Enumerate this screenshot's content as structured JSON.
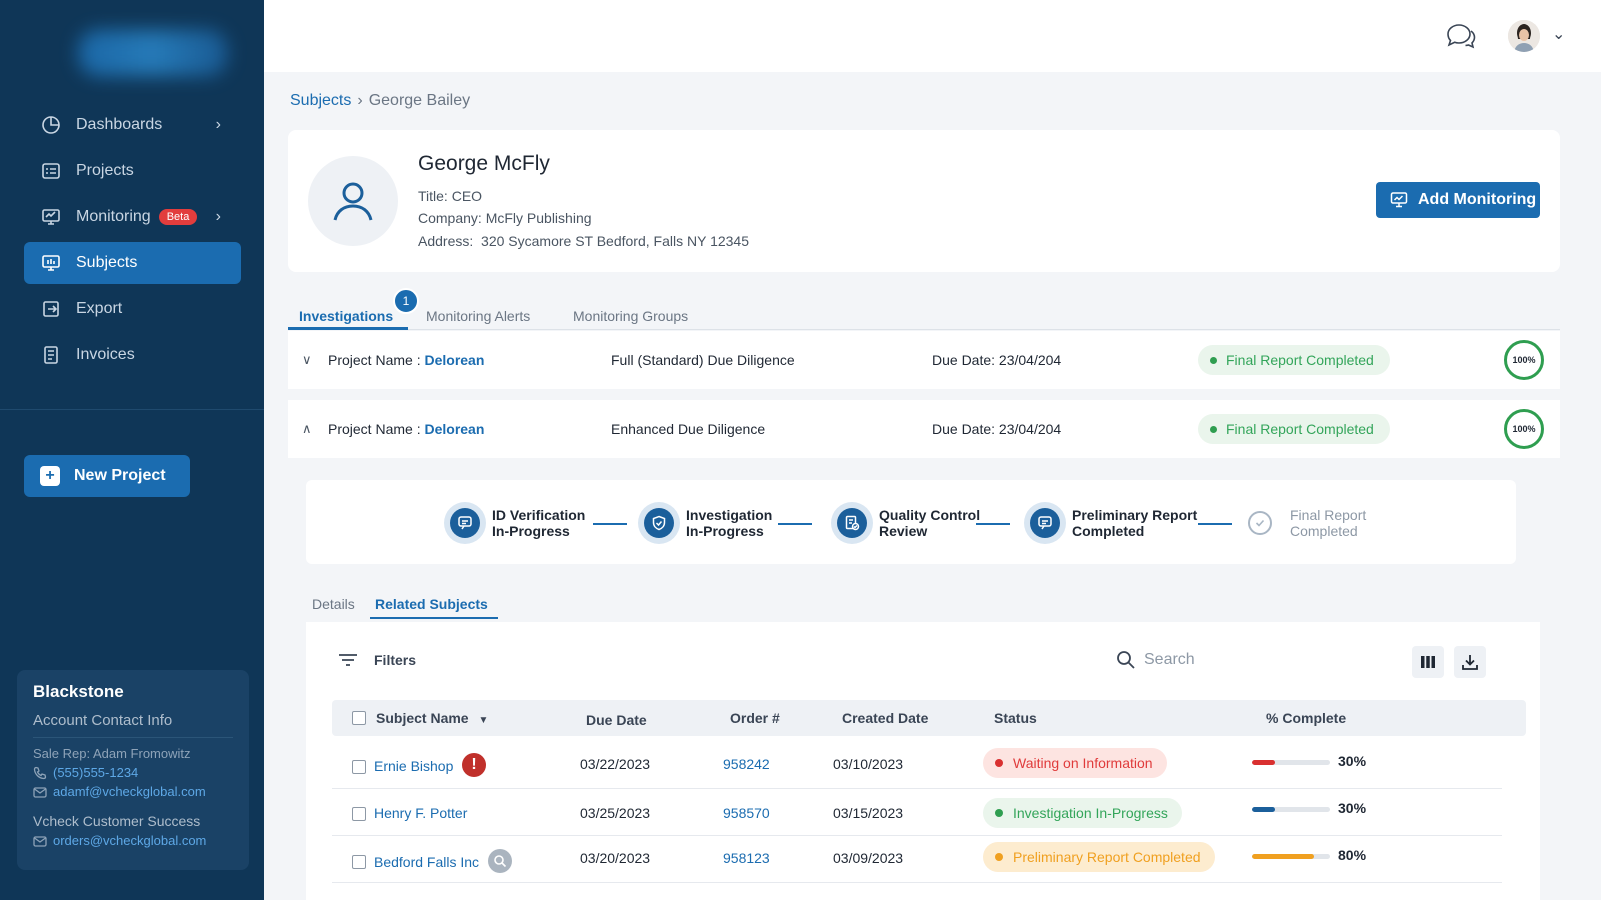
{
  "sidebar": {
    "nav": [
      {
        "label": "Dashboards",
        "icon": "dashboard-icon"
      },
      {
        "label": "Projects",
        "icon": "projects-icon"
      },
      {
        "label": "Monitoring",
        "icon": "monitoring-icon",
        "badge": "Beta"
      },
      {
        "label": "Subjects",
        "icon": "subjects-icon",
        "active": true
      },
      {
        "label": "Export",
        "icon": "export-icon"
      },
      {
        "label": "Invoices",
        "icon": "invoices-icon"
      }
    ],
    "new_project_label": "New Project",
    "account": {
      "company": "Blackstone",
      "heading": "Account Contact Info",
      "sale_rep": "Sale Rep: Adam Fromowitz",
      "phone": "(555)555-1234",
      "email": "adamf@vcheckglobal.com",
      "cs_heading": "Vcheck Customer Success",
      "cs_email": "orders@vcheckglobal.com"
    }
  },
  "breadcrumb": {
    "root": "Subjects",
    "current": "George Bailey"
  },
  "profile": {
    "name": "George McFly",
    "title": "Title: CEO",
    "company": "Company: McFly Publishing",
    "address_label": "Address:",
    "address": "320 Sycamore ST Bedford, Falls NY 12345",
    "add_monitoring_label": "Add Monitoring"
  },
  "tabs": [
    {
      "label": "Investigations",
      "count": "1",
      "active": true
    },
    {
      "label": "Monitoring Alerts"
    },
    {
      "label": "Monitoring Groups"
    }
  ],
  "projects": [
    {
      "name_label": "Project Name :",
      "name": "Delorean",
      "type": "Full (Standard) Due Diligence",
      "due": "Due Date: 23/04/204",
      "status": "Final Report Completed",
      "pct": "100%",
      "expanded": false
    },
    {
      "name_label": "Project Name :",
      "name": "Delorean",
      "type": "Enhanced Due Diligence",
      "due": "Due Date: 23/04/204",
      "status": "Final Report Completed",
      "pct": "100%",
      "expanded": true
    }
  ],
  "steps": [
    {
      "line1": "ID Verification",
      "line2": "In-Progress",
      "state": "done"
    },
    {
      "line1": "Investigation",
      "line2": "In-Progress",
      "state": "done"
    },
    {
      "line1": "Quality Control",
      "line2": "Review",
      "state": "done"
    },
    {
      "line1": "Preliminary Report",
      "line2": "Completed",
      "state": "done"
    },
    {
      "line1": "Final Report",
      "line2": "Completed",
      "state": "pending"
    }
  ],
  "subtabs": [
    {
      "label": "Details"
    },
    {
      "label": "Related Subjects",
      "active": true
    }
  ],
  "table": {
    "filters_label": "Filters",
    "search_placeholder": "Search",
    "columns": [
      "Subject Name",
      "Due Date",
      "Order #",
      "Created Date",
      "Status",
      "% Complete"
    ],
    "rows": [
      {
        "name": "Ernie Bishop",
        "flag": "alert-icon",
        "due": "03/22/2023",
        "order": "958242",
        "created": "03/10/2023",
        "status": "Waiting on Information",
        "status_color": "#e03b3b",
        "status_bg": "#fde4e1",
        "pct": "30%",
        "progress": 0.3,
        "bar_color": "#d93030"
      },
      {
        "name": "Henry F. Potter",
        "flag": "",
        "due": "03/25/2023",
        "order": "958570",
        "created": "03/15/2023",
        "status": "Investigation In-Progress",
        "status_color": "#33a55a",
        "status_bg": "#eaf5ec",
        "pct": "30%",
        "progress": 0.3,
        "bar_color": "#1b5f9b"
      },
      {
        "name": "Bedford Falls Inc",
        "flag": "search-person-icon",
        "due": "03/20/2023",
        "order": "958123",
        "created": "03/09/2023",
        "status": "Preliminary Report Completed",
        "status_color": "#f0a020",
        "status_bg": "#fdeccf",
        "pct": "80%",
        "progress": 0.8,
        "bar_color": "#f0a020"
      }
    ]
  },
  "colors": {
    "sidebar": "#0f3657",
    "accent": "#1b6cb0",
    "success": "#2f9e50"
  }
}
